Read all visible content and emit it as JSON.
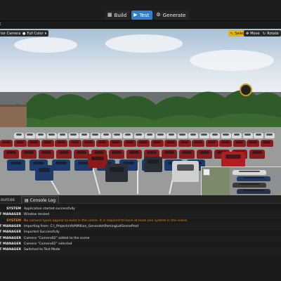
{
  "modes": [
    {
      "label": "Build",
      "icon": "▦",
      "active": false
    },
    {
      "label": "Test",
      "icon": "▶",
      "active": true
    },
    {
      "label": "Generate",
      "icon": "⚙",
      "active": false
    }
  ],
  "subbar": {
    "label": "t"
  },
  "viewport": {
    "camera_select": "tor Camera",
    "color_mode": "Full Color",
    "tools": [
      "Select",
      "Move",
      "Rotate"
    ],
    "accent": "#e6b400"
  },
  "bottom_tabs": [
    {
      "label": "ources",
      "active": false
    },
    {
      "label": "Console Log",
      "active": true
    }
  ],
  "log": [
    {
      "source": "SYSTEM",
      "message": "Application started successfully",
      "level": "info"
    },
    {
      "source": "RT MANAGER",
      "message": "Window resized",
      "level": "info"
    },
    {
      "source": "SYSTEM",
      "message": "No camera types appear to exist in the scene. It is required to have at least one system in the scene.",
      "level": "warn"
    },
    {
      "source": "RT MANAGER",
      "message": "Importing from: C:\\_Projects\\AVAMillion_Generate\\ParkingLotSceneProd",
      "level": "info"
    },
    {
      "source": "RT MANAGER",
      "message": "Imported Successfully",
      "level": "info"
    },
    {
      "source": "RT MANAGER",
      "message": "Camera \"Camera02\" added to the scene",
      "level": "info"
    },
    {
      "source": "RT MANAGER",
      "message": "Camera \"Camera02\" selected",
      "level": "info"
    },
    {
      "source": "RT MANAGER",
      "message": "Switched to Test Mode",
      "level": "info"
    }
  ]
}
